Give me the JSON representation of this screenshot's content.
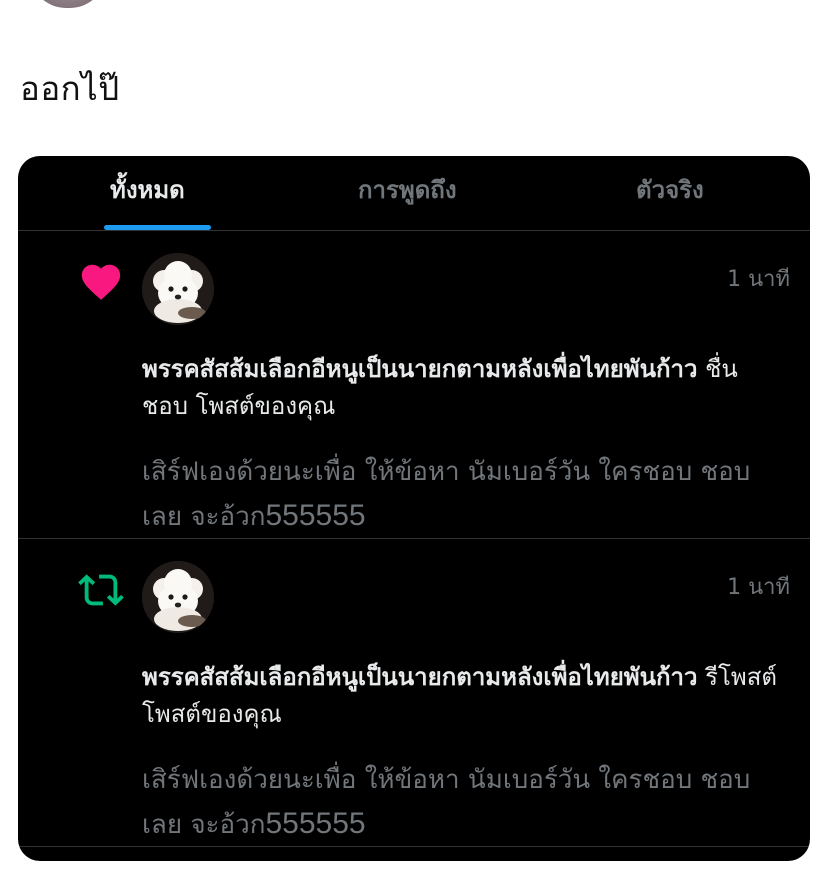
{
  "caption": "ออกไป๊",
  "tabs": [
    {
      "label": "ทั้งหมด",
      "active": true
    },
    {
      "label": "การพูดถึง",
      "active": false
    },
    {
      "label": "ตัวจริง",
      "active": false
    }
  ],
  "notifications": [
    {
      "type_icon": "heart-icon",
      "icon_color": "#f91880",
      "time": "1 นาที",
      "user_name": "พรรคสัสส้มเลือกอีหนูเป็นนายกตามหลังเพื่อไทยพันก้าว",
      "action": "ชื่นชอบ โพสต์ของคุณ",
      "preview": "เสิร์ฟเองด้วยนะเพื่อ ให้ข้อหา นัมเบอร์วัน ใครชอบ ชอบเลย จะอ้วก",
      "preview_number": "555555"
    },
    {
      "type_icon": "retweet-icon",
      "icon_color": "#00ba7c",
      "time": "1 นาที",
      "user_name": "พรรคสัสส้มเลือกอีหนูเป็นนายกตามหลังเพื่อไทยพันก้าว",
      "action": "รีโพสต์ โพสต์ของคุณ",
      "preview": "เสิร์ฟเองด้วยนะเพื่อ ให้ข้อหา นัมเบอร์วัน ใครชอบ ชอบเลย จะอ้วก",
      "preview_number": "555555"
    }
  ]
}
